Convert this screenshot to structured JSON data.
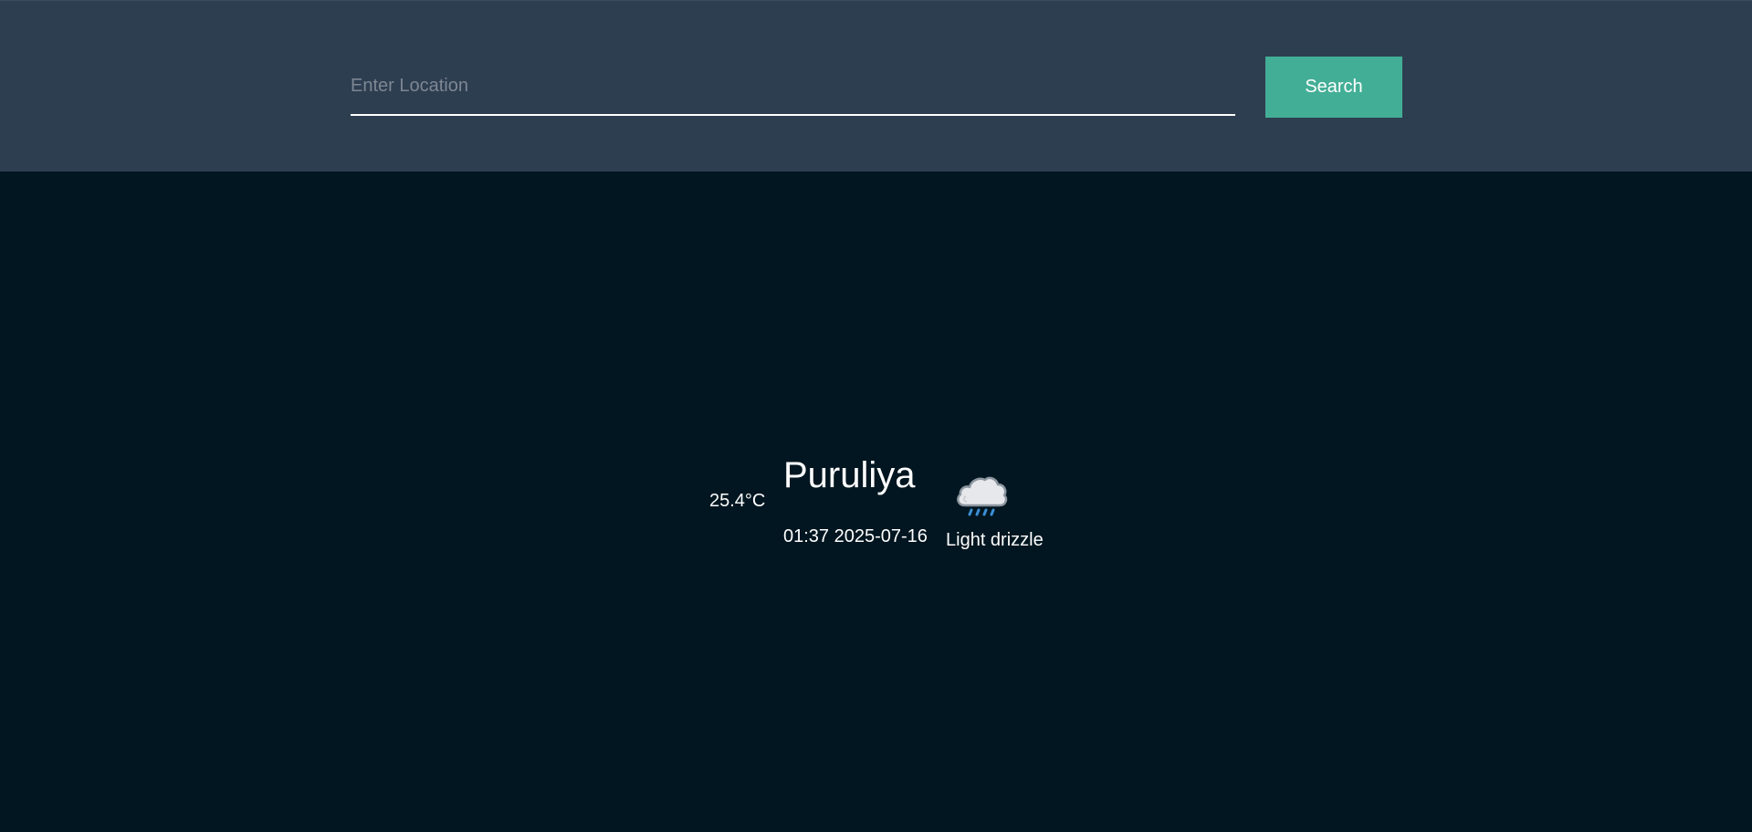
{
  "search": {
    "placeholder": "Enter Location",
    "value": "",
    "button_label": "Search"
  },
  "weather": {
    "temperature": "25.4°C",
    "city": "Puruliya",
    "datetime": "01:37 2025-07-16",
    "condition": "Light drizzle",
    "icon": "cloud-drizzle-icon"
  },
  "colors": {
    "header_bg": "#2e3e51",
    "page_bg": "#011620",
    "accent": "#43ae96",
    "text": "#ffffff"
  }
}
